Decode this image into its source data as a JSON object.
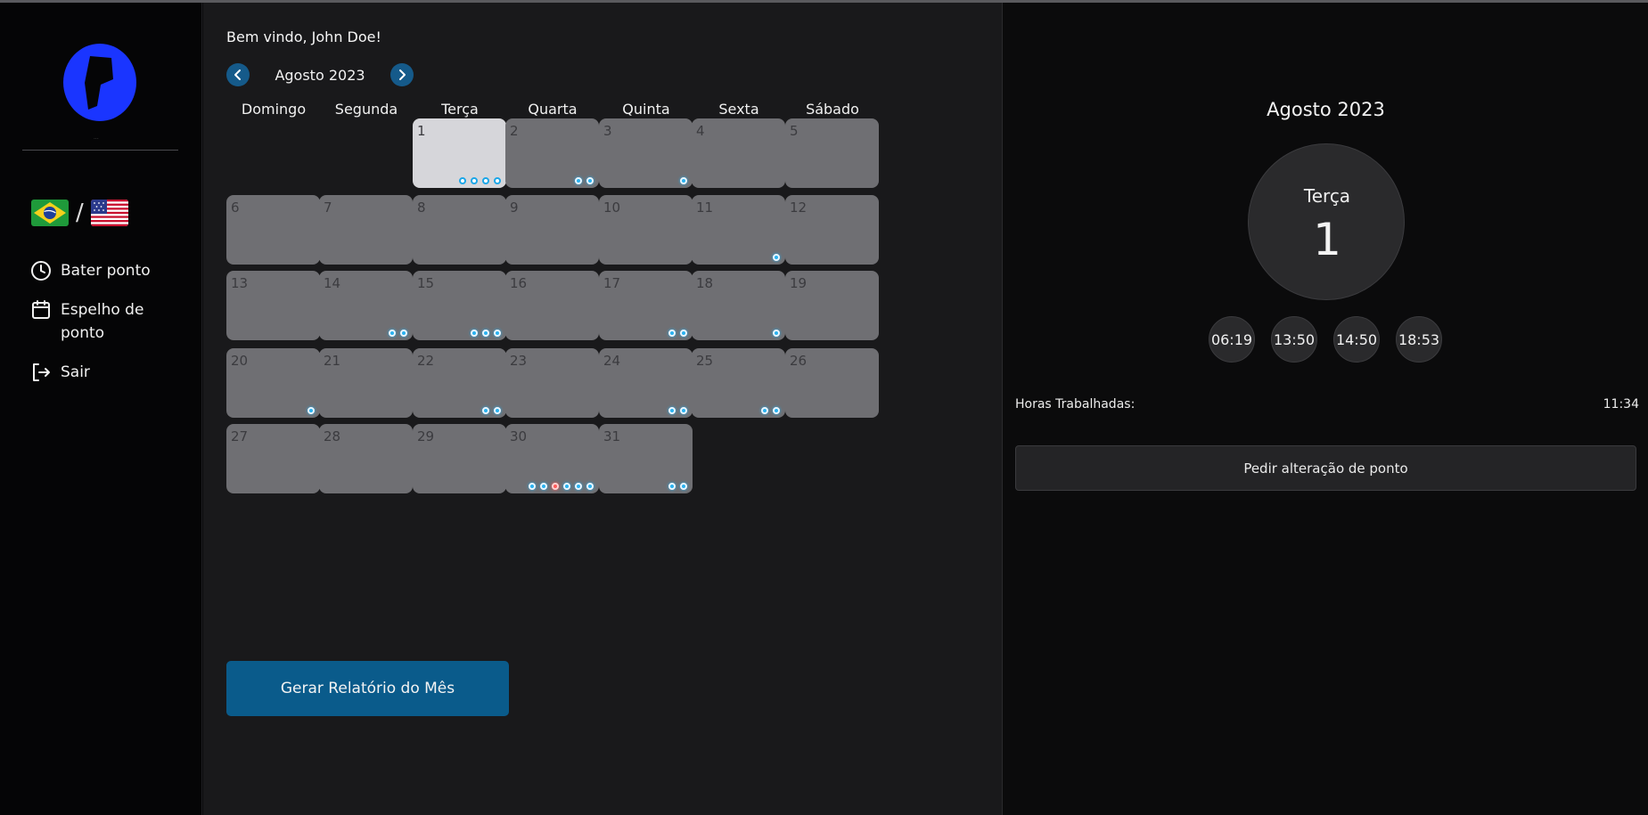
{
  "sidebar": {
    "logo_caption": "...",
    "lang_separator": "/",
    "flags": [
      "brazil-flag-icon",
      "usa-flag-icon"
    ],
    "nav": [
      {
        "icon": "clock-icon",
        "label": "Bater ponto"
      },
      {
        "icon": "calendar-icon",
        "label": "Espelho de ponto"
      },
      {
        "icon": "logout-icon",
        "label": "Sair"
      }
    ]
  },
  "main": {
    "welcome": "Bem vindo, John Doe!",
    "month_label": "Agosto 2023",
    "prev_icon": "chevron-left-icon",
    "next_icon": "chevron-right-icon",
    "weekdays": [
      "Domingo",
      "Segunda",
      "Terça",
      "Quarta",
      "Quinta",
      "Sexta",
      "Sábado"
    ],
    "first_weekday_index": 2,
    "selected_day": 1,
    "days": [
      {
        "num": "1",
        "dots": [
          "ring",
          "ring",
          "ring",
          "ring"
        ]
      },
      {
        "num": "2",
        "dots": [
          "blue",
          "blue"
        ]
      },
      {
        "num": "3",
        "dots": [
          "blue"
        ]
      },
      {
        "num": "4",
        "dots": []
      },
      {
        "num": "5",
        "dots": []
      },
      {
        "num": "6",
        "dots": []
      },
      {
        "num": "7",
        "dots": []
      },
      {
        "num": "8",
        "dots": []
      },
      {
        "num": "9",
        "dots": []
      },
      {
        "num": "10",
        "dots": []
      },
      {
        "num": "11",
        "dots": [
          "blue"
        ]
      },
      {
        "num": "12",
        "dots": []
      },
      {
        "num": "13",
        "dots": []
      },
      {
        "num": "14",
        "dots": [
          "blue",
          "blue"
        ]
      },
      {
        "num": "15",
        "dots": [
          "blue",
          "blue",
          "blue"
        ]
      },
      {
        "num": "16",
        "dots": []
      },
      {
        "num": "17",
        "dots": [
          "blue",
          "blue"
        ]
      },
      {
        "num": "18",
        "dots": [
          "blue"
        ]
      },
      {
        "num": "19",
        "dots": []
      },
      {
        "num": "20",
        "dots": [
          "blue"
        ]
      },
      {
        "num": "21",
        "dots": []
      },
      {
        "num": "22",
        "dots": [
          "blue",
          "blue"
        ]
      },
      {
        "num": "23",
        "dots": []
      },
      {
        "num": "24",
        "dots": [
          "blue",
          "blue"
        ]
      },
      {
        "num": "25",
        "dots": [
          "blue",
          "blue"
        ]
      },
      {
        "num": "26",
        "dots": []
      },
      {
        "num": "27",
        "dots": []
      },
      {
        "num": "28",
        "dots": []
      },
      {
        "num": "29",
        "dots": []
      },
      {
        "num": "30",
        "dots": [
          "blue",
          "blue",
          "red",
          "blue",
          "blue",
          "blue"
        ]
      },
      {
        "num": "31",
        "dots": [
          "blue",
          "blue"
        ]
      }
    ],
    "report_button": "Gerar Relatório do Mês"
  },
  "detail": {
    "month": "Agosto 2023",
    "weekday": "Terça",
    "day": "1",
    "times": [
      "06:19",
      "13:50",
      "14:50",
      "18:53"
    ],
    "hours_label": "Horas Trabalhadas:",
    "hours_value": "11:34",
    "change_button": "Pedir alteração de ponto"
  },
  "colors": {
    "accent": "#0a5b8b",
    "dot_blue": "#2ab2f0",
    "dot_red": "#ff5b5b",
    "day_tile": "#6f6f73",
    "day_selected": "#d6d6da",
    "logo": "#1a35ff"
  }
}
